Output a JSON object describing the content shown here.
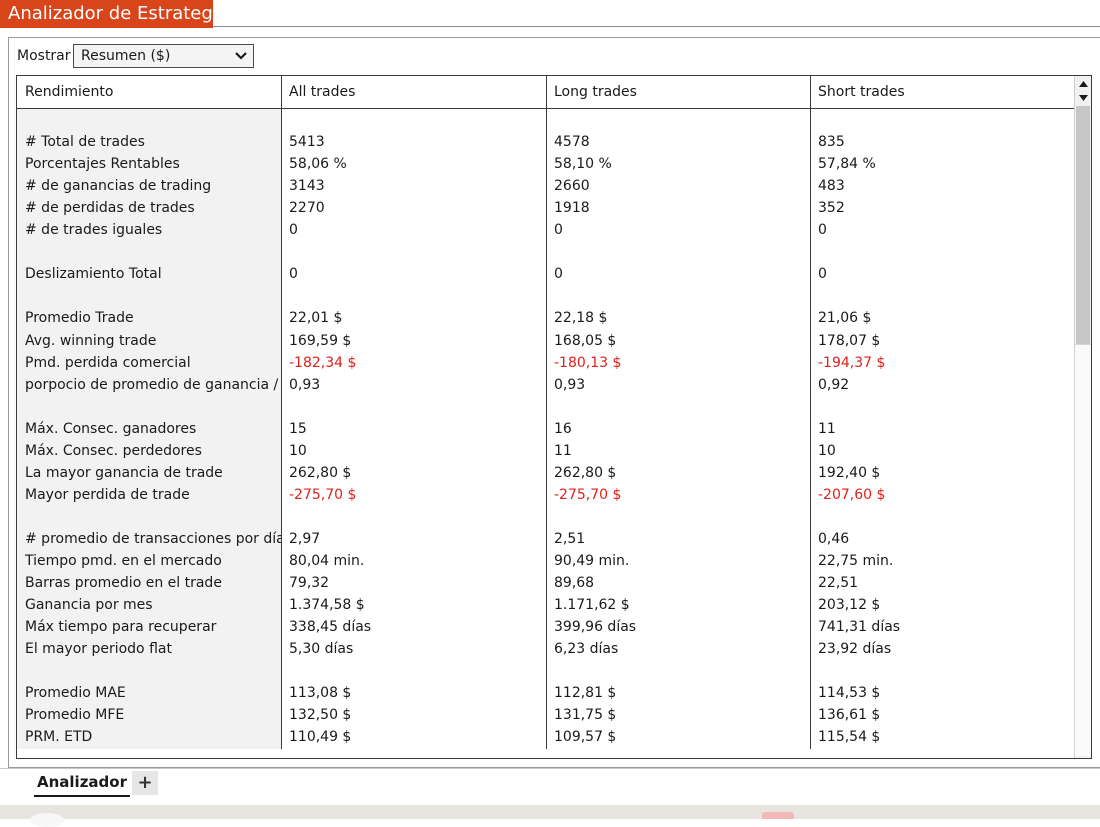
{
  "window": {
    "title": "Analizador de Estrategia"
  },
  "toolbar": {
    "show_label": "Mostrar",
    "show_select_value": "Resumen ($)"
  },
  "table": {
    "headers": [
      "Rendimiento",
      "All trades",
      "Long trades",
      "Short trades"
    ],
    "rows": [
      [
        "",
        "",
        "",
        ""
      ],
      [
        "# Total de trades",
        "5413",
        "4578",
        "835"
      ],
      [
        "Porcentajes Rentables",
        "58,06 %",
        "58,10 %",
        "57,84 %"
      ],
      [
        "# de ganancias de trading",
        "3143",
        "2660",
        "483"
      ],
      [
        "# de perdidas de trades",
        "2270",
        "1918",
        "352"
      ],
      [
        "# de trades iguales",
        "0",
        "0",
        "0"
      ],
      [
        "",
        "",
        "",
        ""
      ],
      [
        "Deslizamiento Total",
        "0",
        "0",
        "0"
      ],
      [
        "",
        "",
        "",
        ""
      ],
      [
        "Promedio Trade",
        "22,01 $",
        "22,18 $",
        "21,06 $"
      ],
      [
        "Avg. winning trade",
        "169,59 $",
        "168,05 $",
        "178,07 $"
      ],
      [
        "Pmd. perdida comercial",
        "-182,34 $",
        "-180,13 $",
        "-194,37 $"
      ],
      [
        "porpocio de promedio de ganancia / pé",
        "0,93",
        "0,93",
        "0,92"
      ],
      [
        "",
        "",
        "",
        ""
      ],
      [
        "Máx. Consec. ganadores",
        "15",
        "16",
        "11"
      ],
      [
        "Máx. Consec. perdedores",
        "10",
        "11",
        "10"
      ],
      [
        "La mayor ganancia de trade",
        "262,80 $",
        "262,80 $",
        "192,40 $"
      ],
      [
        "Mayor perdida de trade",
        "-275,70 $",
        "-275,70 $",
        "-207,60 $"
      ],
      [
        "",
        "",
        "",
        ""
      ],
      [
        "# promedio de transacciones por día",
        "2,97",
        "2,51",
        "0,46"
      ],
      [
        "Tiempo pmd. en el mercado",
        "80,04 min.",
        "90,49 min.",
        "22,75 min."
      ],
      [
        "Barras promedio en el trade",
        "79,32",
        "89,68",
        "22,51"
      ],
      [
        "Ganancia por mes",
        "1.374,58 $",
        "1.171,62 $",
        "203,12 $"
      ],
      [
        "Máx tiempo para recuperar",
        "338,45 días",
        "399,96 días",
        "741,31 días"
      ],
      [
        "El mayor periodo flat",
        "5,30 días",
        "6,23 días",
        "23,92 días"
      ],
      [
        "",
        "",
        "",
        ""
      ],
      [
        "Promedio MAE",
        "113,08 $",
        "112,81 $",
        "114,53 $"
      ],
      [
        "Promedio MFE",
        "132,50 $",
        "131,75 $",
        "136,61 $"
      ],
      [
        "PRM. ETD",
        "110,49 $",
        "109,57 $",
        "115,54 $"
      ]
    ]
  },
  "tabs": {
    "active_label": "Analizador",
    "add_label": "+"
  },
  "colors": {
    "accent": "#d9451b",
    "negative": "#e0201b"
  },
  "icons": {
    "select": "chevron-down-icon",
    "scroll_up": "arrow-up-icon",
    "scroll_down": "arrow-down-icon",
    "add_tab": "plus-icon"
  }
}
